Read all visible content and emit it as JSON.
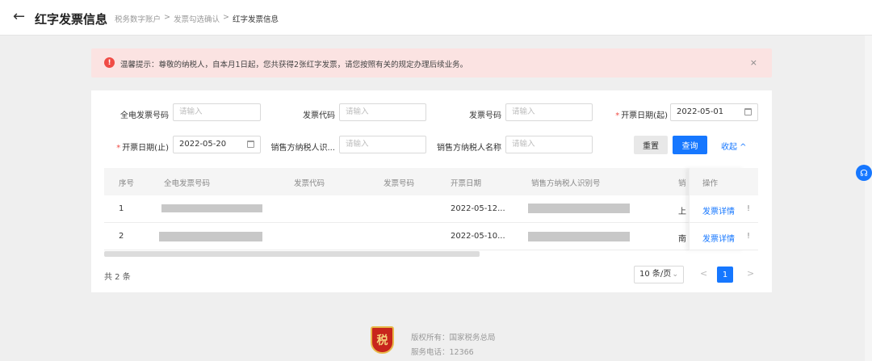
{
  "header": {
    "back_icon": "arrow-left-icon",
    "title": "红字发票信息",
    "breadcrumb": [
      "税务数字账户",
      "发票勾选确认",
      "红字发票信息"
    ],
    "separator": ">"
  },
  "alert": {
    "icon": "!",
    "text": "温馨提示：尊敬的纳税人，自本月1日起，您共获得2张红字发票，请您按照有关的规定办理后续业务。",
    "close": "×",
    "color": "#fbe3e2"
  },
  "filters": {
    "full_invoice_no": {
      "label": "全电发票号码",
      "placeholder": "请输入"
    },
    "invoice_code": {
      "label": "发票代码",
      "placeholder": "请输入"
    },
    "invoice_no": {
      "label": "发票号码",
      "placeholder": "请输入"
    },
    "date_start": {
      "label": "开票日期(起)",
      "value": "2022-05-01",
      "required": "*"
    },
    "date_end": {
      "label": "开票日期(止)",
      "value": "2022-05-20",
      "required": "*"
    },
    "seller_tax_id": {
      "label": "销售方纳税人识...",
      "placeholder": "请输入"
    },
    "seller_name": {
      "label": "销售方纳税人名称",
      "placeholder": "请输入"
    },
    "reset_label": "重置",
    "query_label": "查询",
    "collapse_label": "收起 ^"
  },
  "table": {
    "columns": [
      "序号",
      "全电发票号码",
      "发票代码",
      "发票号码",
      "开票日期",
      "销售方纳税人识别号",
      "销",
      "操作"
    ],
    "rows": [
      {
        "index": "1",
        "date": "2022-05-12...",
        "seller": "上",
        "action": "发票详情",
        "extra": "!"
      },
      {
        "index": "2",
        "date": "2022-05-10...",
        "seller": "南",
        "action": "发票详情",
        "extra": "!"
      }
    ]
  },
  "pagination": {
    "total": "共 2 条",
    "page_size": "10 条/页",
    "current_page": "1",
    "prev": "<",
    "next": ">"
  },
  "footer": {
    "copyright": "版权所有：国家税务总局",
    "hotline": "服务电话：12366"
  },
  "colors": {
    "primary": "#1677ff",
    "danger": "#f04b45"
  }
}
